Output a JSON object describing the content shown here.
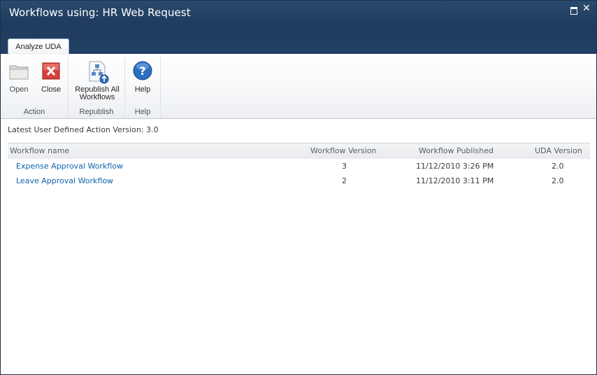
{
  "window": {
    "title": "Workflows using: HR Web Request",
    "maximize_icon": "maximize-icon",
    "close_icon": "close-icon"
  },
  "ribbon": {
    "tab_label": "Analyze UDA",
    "groups": [
      {
        "label": "Action",
        "buttons": [
          {
            "label": "Open",
            "icon": "folder-icon",
            "enabled": false
          },
          {
            "label": "Close",
            "icon": "close-red-icon",
            "enabled": true
          }
        ]
      },
      {
        "label": "Republish",
        "buttons": [
          {
            "label_line1": "Republish All",
            "label_line2": "Workflows",
            "icon": "republish-icon",
            "enabled": true
          }
        ]
      },
      {
        "label": "Help",
        "buttons": [
          {
            "label": "Help",
            "icon": "help-icon",
            "enabled": true
          }
        ]
      }
    ]
  },
  "content": {
    "uda_version_text": "Latest User Defined Action Version: 3.0",
    "columns": [
      "Workflow name",
      "Workflow Version",
      "Workflow Published",
      "UDA Version"
    ],
    "rows": [
      {
        "name": "Expense Approval Workflow",
        "version": "3",
        "published": "11/12/2010 3:26 PM",
        "uda_version": "2.0"
      },
      {
        "name": "Leave Approval Workflow",
        "version": "2",
        "published": "11/12/2010 3:11 PM",
        "uda_version": "2.0"
      }
    ]
  },
  "colors": {
    "title_bar": "#213f64",
    "link": "#0f63ae",
    "close_red": "#d8403b",
    "help_blue": "#2a6fc0"
  }
}
